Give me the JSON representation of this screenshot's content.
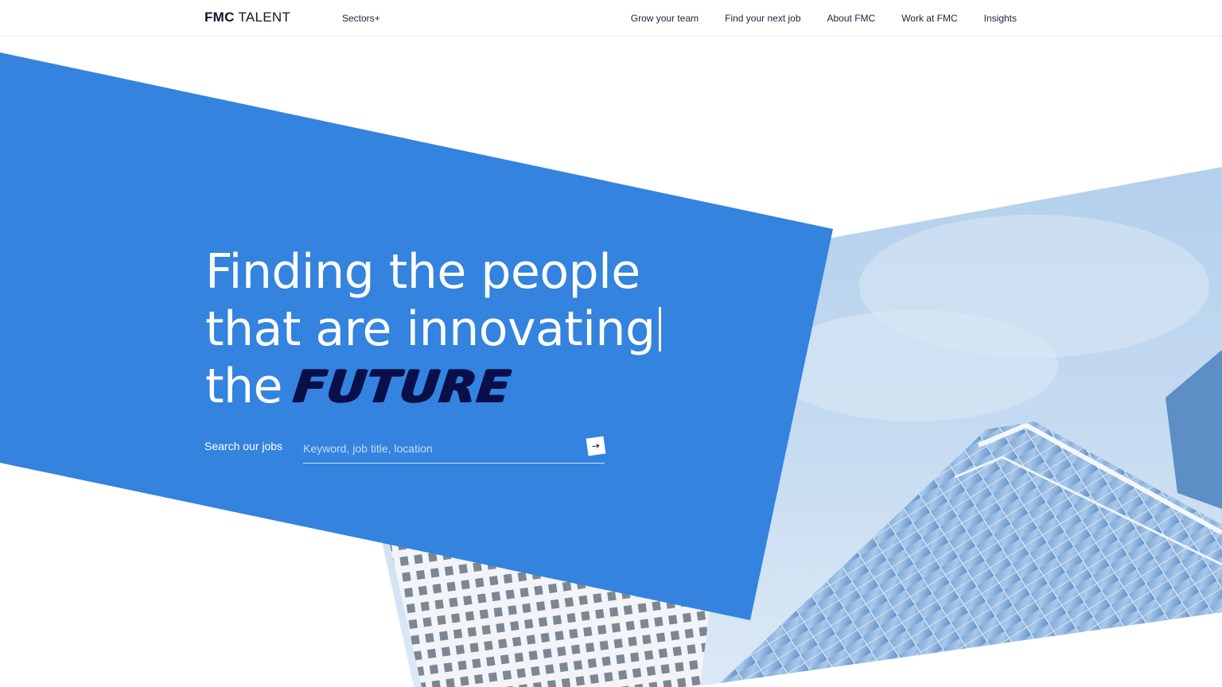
{
  "header": {
    "logo_bold": "FMC",
    "logo_light": "TALENT",
    "sectors_label": "Sectors",
    "sectors_icon": "plus-icon",
    "nav_items": [
      {
        "label": "Grow your team"
      },
      {
        "label": "Find your next job"
      },
      {
        "label": "About FMC"
      },
      {
        "label": "Work at FMC"
      },
      {
        "label": "Insights"
      }
    ]
  },
  "hero": {
    "headline_line1": "Finding the people",
    "headline_line2": "that are innovating",
    "headline_line3_prefix": "the",
    "headline_highlight": "FUTURE"
  },
  "search": {
    "label": "Search our jobs",
    "placeholder": "Keyword, job title, location",
    "value": "",
    "submit_icon": "arrow-right-icon"
  },
  "colors": {
    "primary_blue": "#3383df",
    "highlight_navy": "#0a0f4a",
    "header_text": "#23233d"
  }
}
